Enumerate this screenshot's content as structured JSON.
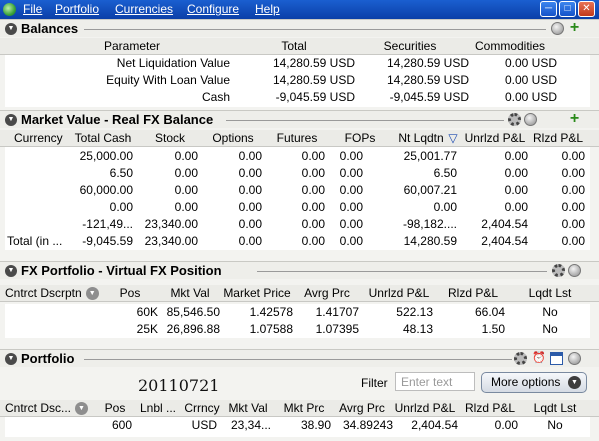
{
  "menu": {
    "items": [
      "File",
      "Portfolio",
      "Currencies",
      "Configure",
      "Help"
    ]
  },
  "balances": {
    "title": "Balances",
    "columns": [
      "Parameter",
      "Total",
      "Securities",
      "Commodities"
    ],
    "rows": [
      [
        "Net Liquidation Value",
        "14,280.59 USD",
        "14,280.59 USD",
        "0.00 USD"
      ],
      [
        "Equity With Loan Value",
        "14,280.59 USD",
        "14,280.59 USD",
        "0.00 USD"
      ],
      [
        "Cash",
        "-9,045.59 USD",
        "-9,045.59 USD",
        "0.00 USD"
      ]
    ]
  },
  "market_value": {
    "title": "Market Value - Real FX Balance",
    "columns": [
      "Currency",
      "Total Cash",
      "Stock",
      "Options",
      "Futures",
      "FOPs",
      "Nt Lqdtn",
      "Unrlzd P&L",
      "Rlzd P&L"
    ],
    "sort_marker": "▽",
    "rows": [
      [
        "",
        "25,000.00",
        "0.00",
        "0.00",
        "0.00",
        "0.00",
        "25,001.77",
        "0.00",
        "0.00"
      ],
      [
        "",
        "6.50",
        "0.00",
        "0.00",
        "0.00",
        "0.00",
        "6.50",
        "0.00",
        "0.00"
      ],
      [
        "",
        "60,000.00",
        "0.00",
        "0.00",
        "0.00",
        "0.00",
        "60,007.21",
        "0.00",
        "0.00"
      ],
      [
        "",
        "0.00",
        "0.00",
        "0.00",
        "0.00",
        "0.00",
        "0.00",
        "0.00",
        "0.00"
      ],
      [
        "",
        "-121,49...",
        "23,340.00",
        "0.00",
        "0.00",
        "0.00",
        "-98,182....",
        "2,404.54",
        "0.00"
      ],
      [
        "Total (in ...",
        "-9,045.59",
        "23,340.00",
        "0.00",
        "0.00",
        "0.00",
        "14,280.59",
        "2,404.54",
        "0.00"
      ]
    ]
  },
  "fx_portfolio": {
    "title": "FX Portfolio - Virtual FX Position",
    "columns": [
      "Cntrct Dscrptn",
      "Pos",
      "Mkt Val",
      "Market Price",
      "Avrg Prc",
      "Unrlzd P&L",
      "Rlzd P&L",
      "Lqdt Lst"
    ],
    "rows": [
      [
        "",
        "60K",
        "85,546.50",
        "1.42578",
        "1.41707",
        "522.13",
        "66.04",
        "No"
      ],
      [
        "",
        "25K",
        "26,896.88",
        "1.07588",
        "1.07395",
        "48.13",
        "1.50",
        "No"
      ]
    ]
  },
  "portfolio": {
    "title": "Portfolio",
    "stamp": "20110721",
    "filter_label": "Filter",
    "filter_placeholder": "Enter text",
    "more_options": "More options",
    "columns": [
      "Cntrct Dsc...",
      "Pos",
      "Lnbl ...",
      "Crrncy",
      "Mkt Val",
      "Mkt Prc",
      "Avrg Prc",
      "Unrlzd P&L",
      "Rlzd P&L",
      "Lqdt Lst"
    ],
    "rows": [
      [
        "",
        "600",
        "",
        "USD",
        "23,34...",
        "38.90",
        "34.89243",
        "2,404.54",
        "0.00",
        "No"
      ]
    ]
  },
  "colors": {
    "menubar": "#0b3fa8",
    "header_bg": "#eeeeea",
    "plus_icon": "#2a8a1a"
  }
}
